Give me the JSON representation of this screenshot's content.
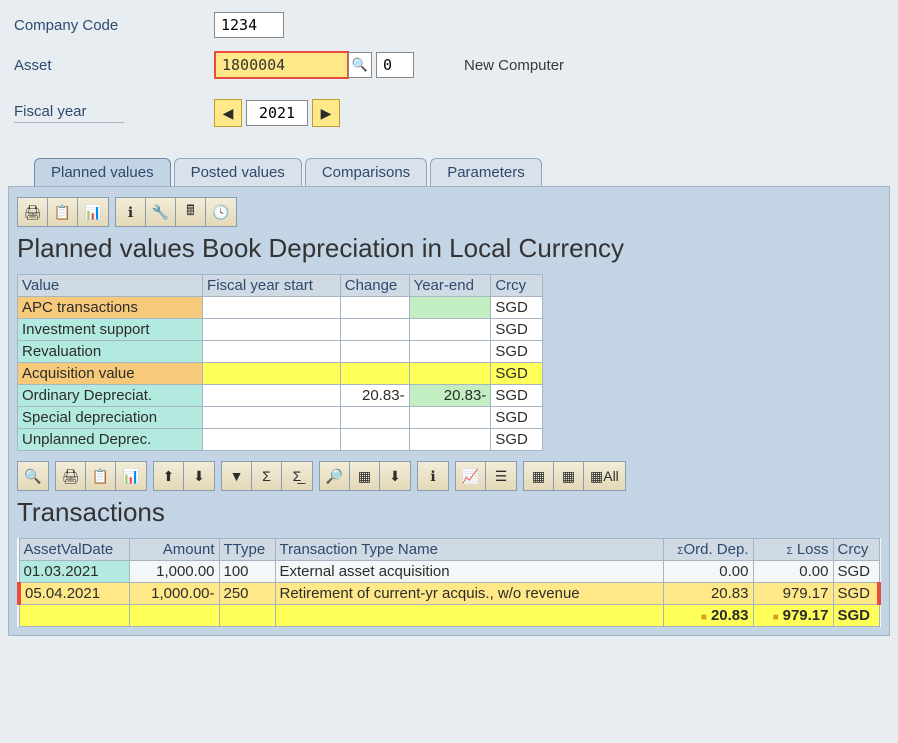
{
  "header": {
    "company_code_label": "Company Code",
    "company_code_value": "1234",
    "asset_label": "Asset",
    "asset_value": "1800004",
    "asset_sub_value": "0",
    "asset_desc": "New Computer",
    "fiscal_year_label": "Fiscal year",
    "fiscal_year_value": "2021"
  },
  "tabs": [
    "Planned values",
    "Posted values",
    "Comparisons",
    "Parameters"
  ],
  "planned": {
    "title": "Planned values Book Depreciation in Local Currency",
    "cols": [
      "Value",
      "Fiscal year start",
      "Change",
      "Year-end",
      "Crcy"
    ],
    "rows": [
      {
        "label": "APC transactions",
        "fy": "",
        "chg": "",
        "ye": "",
        "crcy": "SGD",
        "label_cls": "cell-orange",
        "fy_cls": "cell-white",
        "chg_cls": "cell-white",
        "ye_cls": "cell-green",
        "crcy_cls": "cell-white"
      },
      {
        "label": "Investment support",
        "fy": "",
        "chg": "",
        "ye": "",
        "crcy": "SGD",
        "label_cls": "cell-cyan",
        "fy_cls": "cell-white",
        "chg_cls": "cell-white",
        "ye_cls": "cell-white",
        "crcy_cls": "cell-white"
      },
      {
        "label": "Revaluation",
        "fy": "",
        "chg": "",
        "ye": "",
        "crcy": "SGD",
        "label_cls": "cell-cyan",
        "fy_cls": "cell-white",
        "chg_cls": "cell-white",
        "ye_cls": "cell-white",
        "crcy_cls": "cell-white"
      },
      {
        "label": "Acquisition value",
        "fy": "",
        "chg": "",
        "ye": "",
        "crcy": "SGD",
        "label_cls": "cell-orange",
        "fy_cls": "cell-yellow",
        "chg_cls": "cell-yellow",
        "ye_cls": "cell-yellow",
        "crcy_cls": "cell-yellow"
      },
      {
        "label": "Ordinary Depreciat.",
        "fy": "",
        "chg": "20.83-",
        "ye": "20.83-",
        "crcy": "SGD",
        "label_cls": "cell-cyan",
        "fy_cls": "cell-white",
        "chg_cls": "cell-white",
        "ye_cls": "cell-green",
        "crcy_cls": "cell-white"
      },
      {
        "label": "Special depreciation",
        "fy": "",
        "chg": "",
        "ye": "",
        "crcy": "SGD",
        "label_cls": "cell-cyan",
        "fy_cls": "cell-white",
        "chg_cls": "cell-white",
        "ye_cls": "cell-white",
        "crcy_cls": "cell-white"
      },
      {
        "label": "Unplanned Deprec.",
        "fy": "",
        "chg": "",
        "ye": "",
        "crcy": "SGD",
        "label_cls": "cell-cyan",
        "fy_cls": "cell-white",
        "chg_cls": "cell-white",
        "ye_cls": "cell-white",
        "crcy_cls": "cell-white"
      }
    ]
  },
  "transactions": {
    "title": "Transactions",
    "cols": [
      "AssetValDate",
      "Amount",
      "TType",
      "Transaction Type Name",
      "Ord. Dep.",
      "Loss",
      "Crcy"
    ],
    "rows": [
      {
        "date": "01.03.2021",
        "amount": "1,000.00",
        "ttype": "100",
        "name": "External asset acquisition",
        "ord": "0.00",
        "loss": "0.00",
        "crcy": "SGD",
        "hl": false
      },
      {
        "date": "05.04.2021",
        "amount": "1,000.00-",
        "ttype": "250",
        "name": "Retirement of current-yr acquis., w/o revenue",
        "ord": "20.83",
        "loss": "979.17",
        "crcy": "SGD",
        "hl": true
      }
    ],
    "total": {
      "ord": "20.83",
      "loss": "979.17",
      "crcy": "SGD"
    },
    "all_label": "All"
  }
}
